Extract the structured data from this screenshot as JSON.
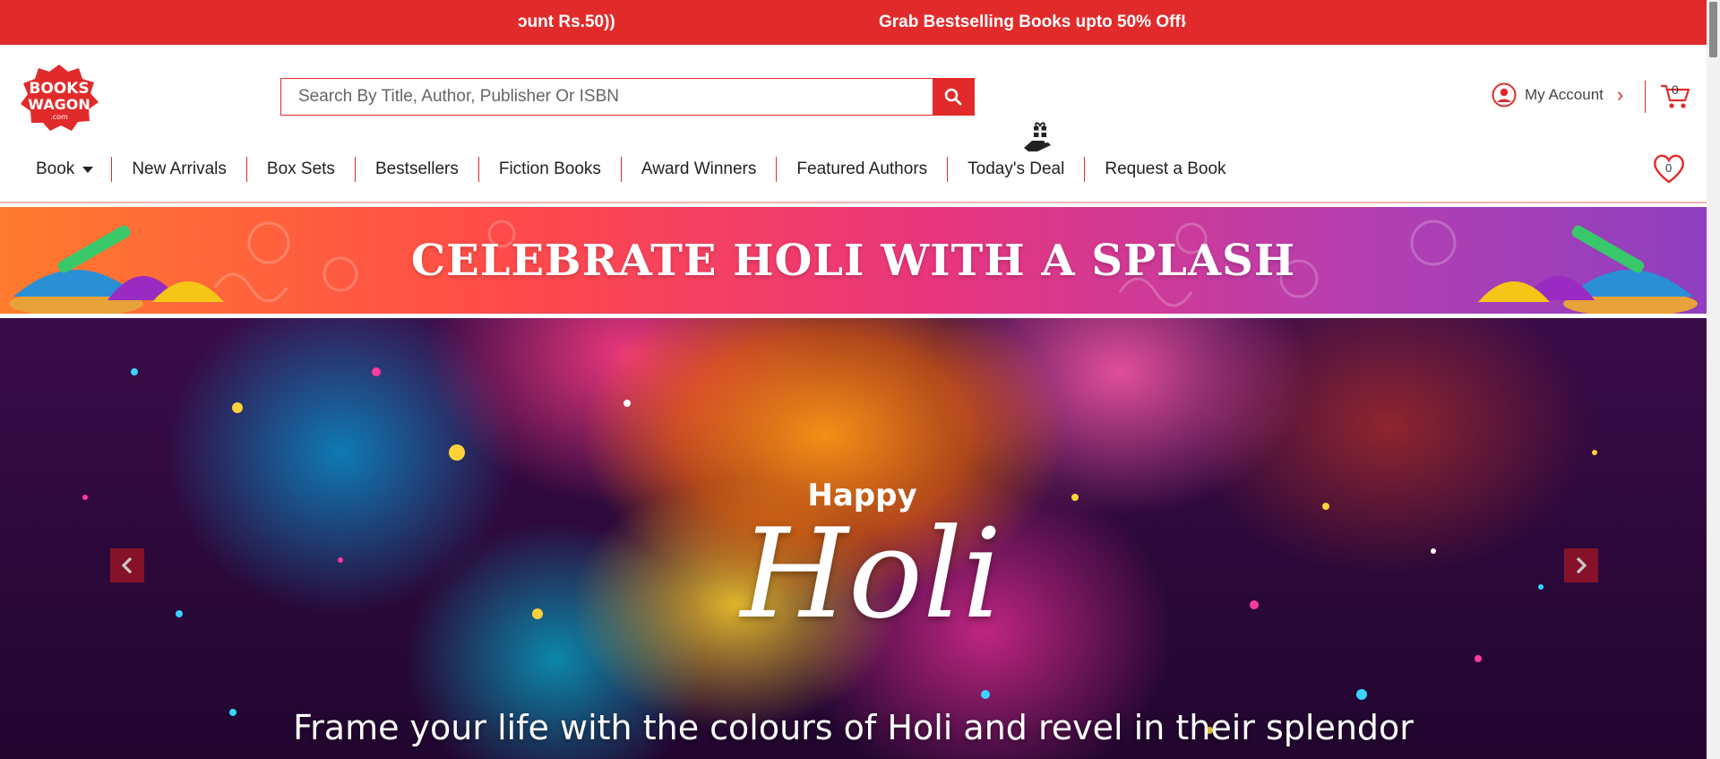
{
  "promo": {
    "left_text": "ɔunt Rs.50))",
    "main_text": "Grab Bestselling Books upto 50% Off!",
    "arrow": "›"
  },
  "brand": {
    "logo_line1": "BOOKS",
    "logo_line2": "WAGON",
    "logo_line3": ".com",
    "color": "#e12b2b"
  },
  "search": {
    "placeholder": "Search By Title, Author, Publisher Or ISBN",
    "value": ""
  },
  "account": {
    "label": "My Account",
    "arrow": "›"
  },
  "cart": {
    "count": "0"
  },
  "wishlist": {
    "count": "0"
  },
  "nav": {
    "items": [
      {
        "label": "Book"
      },
      {
        "label": "New Arrivals"
      },
      {
        "label": "Box Sets"
      },
      {
        "label": "Bestsellers"
      },
      {
        "label": "Fiction Books"
      },
      {
        "label": "Award Winners"
      },
      {
        "label": "Featured Authors"
      },
      {
        "label": "Today's Deal"
      },
      {
        "label": "Request a Book"
      }
    ]
  },
  "strip": {
    "title": "CELEBRATE HOLI WITH A SPLASH"
  },
  "hero": {
    "happy": "Happy",
    "holi": "Holi",
    "tagline": "Frame your life with the colours of Holi and revel in their splendor"
  }
}
